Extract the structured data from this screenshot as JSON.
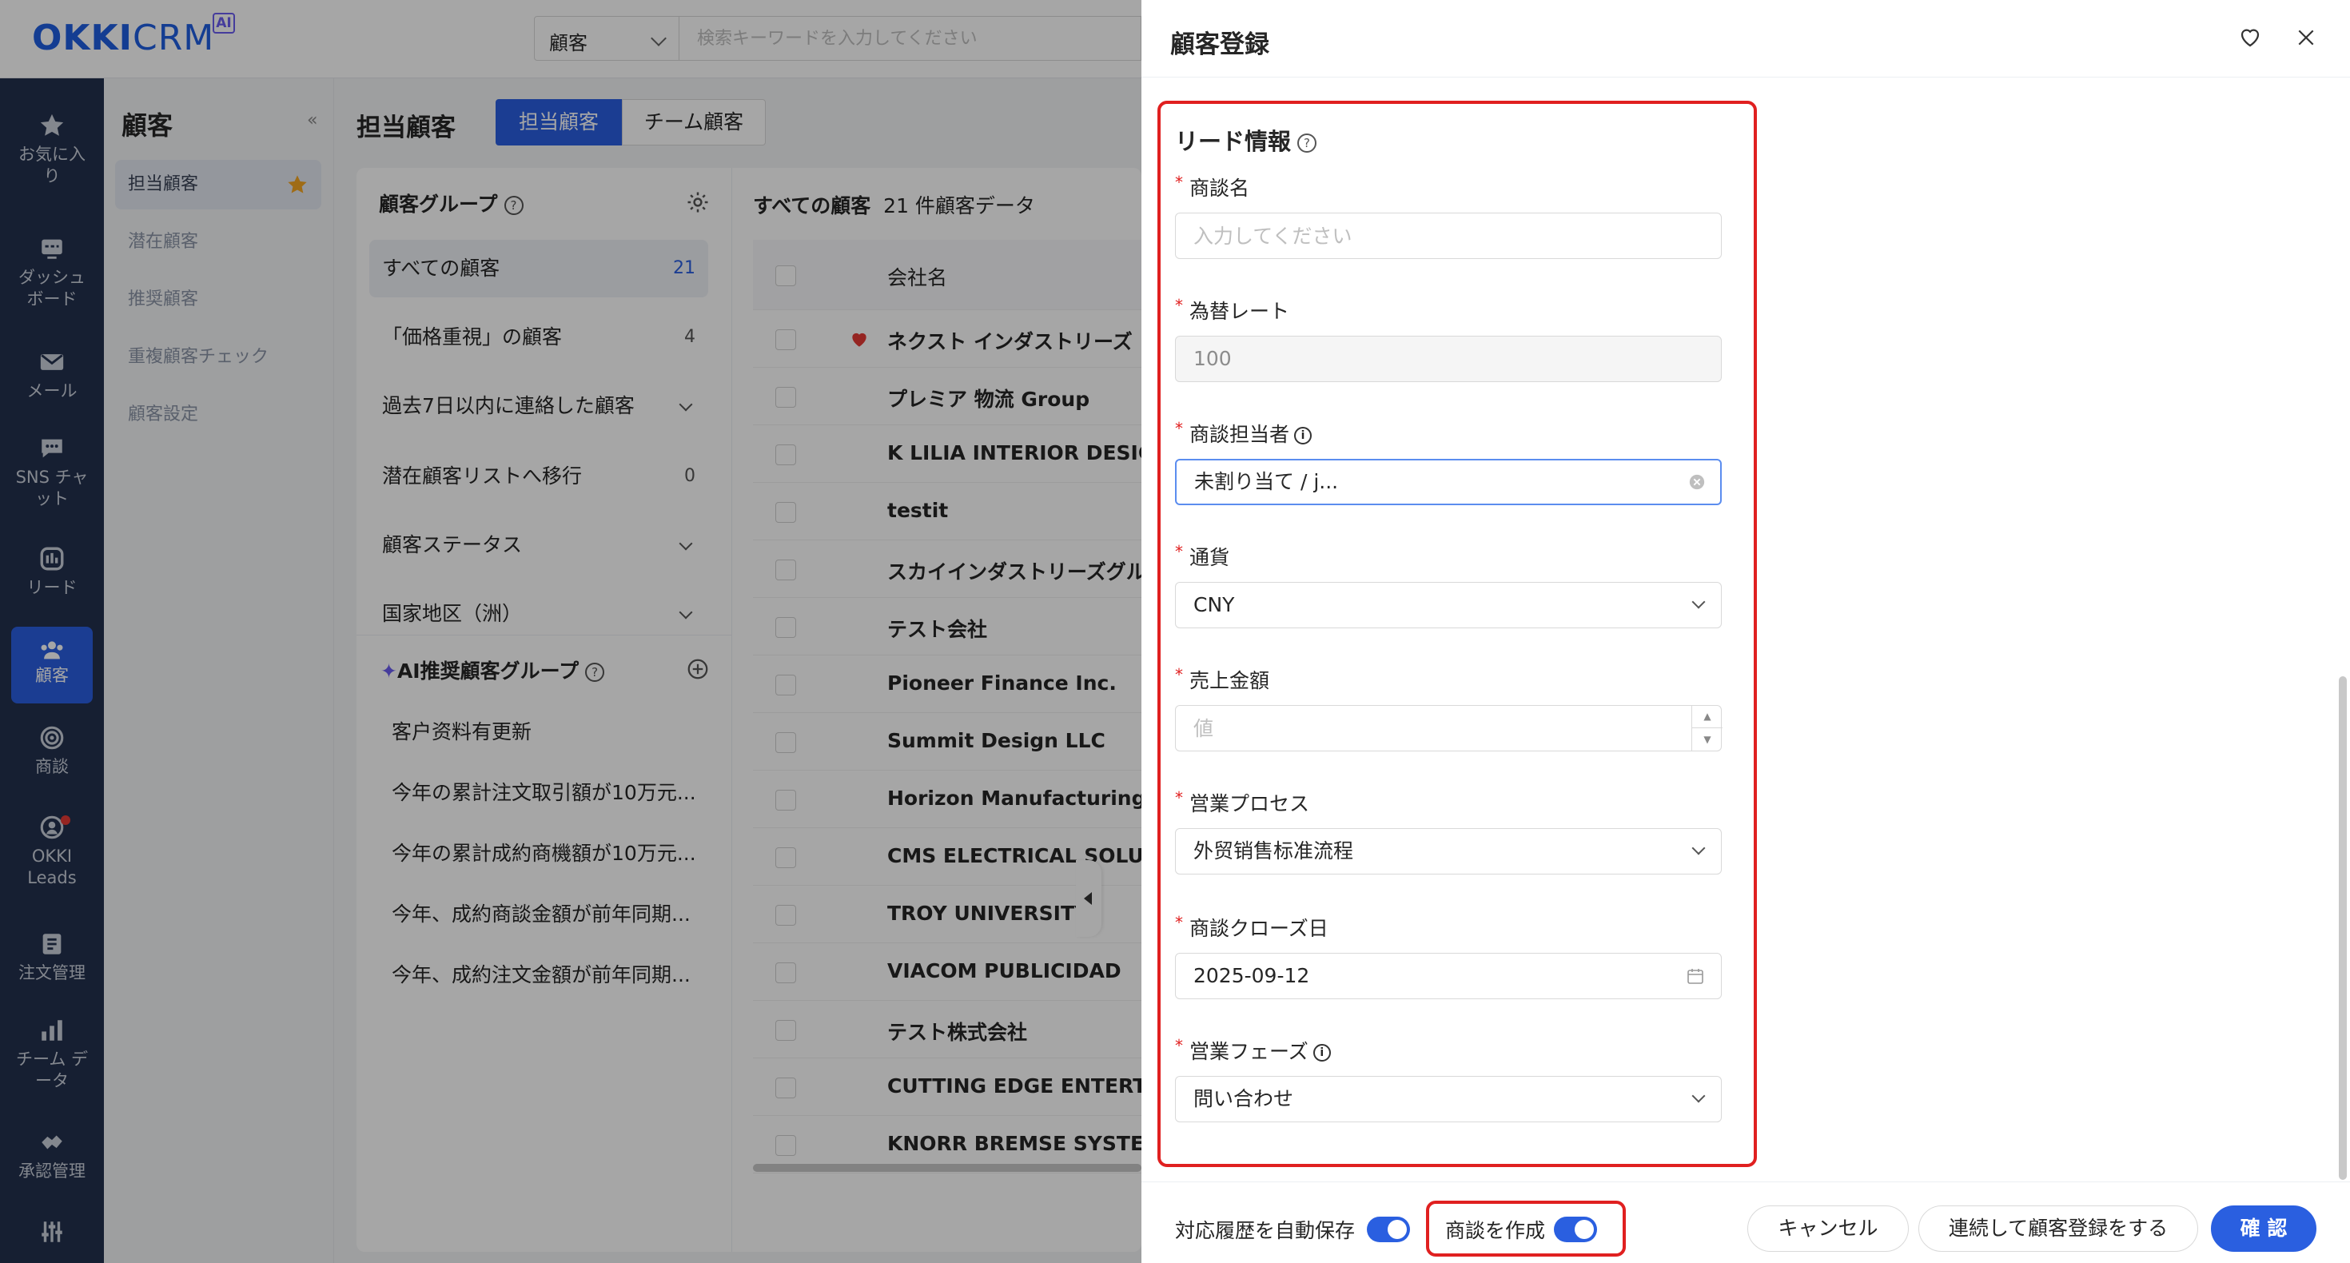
{
  "app": {
    "logo_main": "OKKI",
    "logo_sub": "CRM",
    "logo_badge": "AI"
  },
  "search": {
    "type_value": "顧客",
    "placeholder": "検索キーワードを入力してください"
  },
  "nav": [
    {
      "label": "お気に入り",
      "icon": "star-icon"
    },
    {
      "label": "ダッシュボード",
      "icon": "dashboard-icon"
    },
    {
      "label": "メール",
      "icon": "mail-icon"
    },
    {
      "label": "SNS チャット",
      "icon": "chat-icon"
    },
    {
      "label": "リード",
      "icon": "lead-icon"
    },
    {
      "label": "顧客",
      "icon": "customer-icon"
    },
    {
      "label": "商談",
      "icon": "target-icon"
    },
    {
      "label": "OKKI Leads",
      "icon": "leads-icon"
    },
    {
      "label": "注文管理",
      "icon": "order-icon"
    },
    {
      "label": "チーム データ",
      "icon": "bar-chart-icon"
    },
    {
      "label": "承認管理",
      "icon": "approval-icon"
    },
    {
      "label": "",
      "icon": "settings-sliders-icon"
    }
  ],
  "submenu": {
    "title": "顧客",
    "items": [
      "担当顧客",
      "潜在顧客",
      "推奨顧客",
      "重複顧客チェック",
      "顧客設定"
    ]
  },
  "main": {
    "title": "担当顧客",
    "tabs": [
      "担当顧客",
      "チーム顧客"
    ]
  },
  "groups": {
    "title": "顧客グループ",
    "items": [
      {
        "label": "すべての顧客",
        "count": "21"
      },
      {
        "label": "「価格重視」の顧客",
        "count": "4"
      },
      {
        "label": "過去7日以内に連絡した顧客",
        "count": ""
      },
      {
        "label": "潜在顧客リストへ移行",
        "count": "0"
      },
      {
        "label": "顧客ステータス",
        "count": ""
      },
      {
        "label": "国家地区（洲）",
        "count": ""
      }
    ],
    "ai_title": "AI推奨顧客グループ",
    "ai_items": [
      "客户资料有更新",
      "今年の累計注文取引額が10万元...",
      "今年の累計成約商機額が10万元...",
      "今年、成約商談金額が前年同期...",
      "今年、成約注文金額が前年同期..."
    ]
  },
  "list": {
    "header_all": "すべての顧客",
    "header_count": "21 件顧客データ",
    "column": "会社名",
    "rows": [
      "ネクスト インダストリーズ",
      "プレミア 物流 Group",
      "K LILIA INTERIOR DESIGN",
      "testit",
      "スカイインダストリーズグル",
      "テスト会社",
      "Pioneer Finance Inc.",
      "Summit Design LLC",
      "Horizon Manufacturing Inc",
      "CMS ELECTRICAL SOLUTIO",
      "TROY UNIVERSITY",
      "VIACOM PUBLICIDAD",
      "テスト株式会社",
      "CUTTING EDGE ENTERTAI",
      "KNORR BREMSE SYSTEMS"
    ]
  },
  "drawer": {
    "title": "顧客登録",
    "section": "リード情報",
    "fields": {
      "deal_name": {
        "label": "商談名",
        "placeholder": "入力してください"
      },
      "rate": {
        "label": "為替レート",
        "value": "100"
      },
      "owner": {
        "label": "商談担当者",
        "value": "未割り当て / j..."
      },
      "currency": {
        "label": "通貨",
        "value": "CNY"
      },
      "amount": {
        "label": "売上金額",
        "placeholder": "値"
      },
      "process": {
        "label": "営業プロセス",
        "value": "外贸销售标准流程"
      },
      "close_date": {
        "label": "商談クローズ日",
        "value": "2025-09-12"
      },
      "stage": {
        "label": "営業フェーズ",
        "value": "問い合わせ"
      }
    },
    "footer": {
      "autosave_label": "対応履歴を自動保存",
      "create_deal_label": "商談を作成",
      "cancel": "キャンセル",
      "continue": "連続して顧客登録をする",
      "confirm": "確 認"
    }
  },
  "colors": {
    "accent": "#2a5fe0",
    "nav_bg": "#23304d",
    "highlight": "#e02020"
  }
}
